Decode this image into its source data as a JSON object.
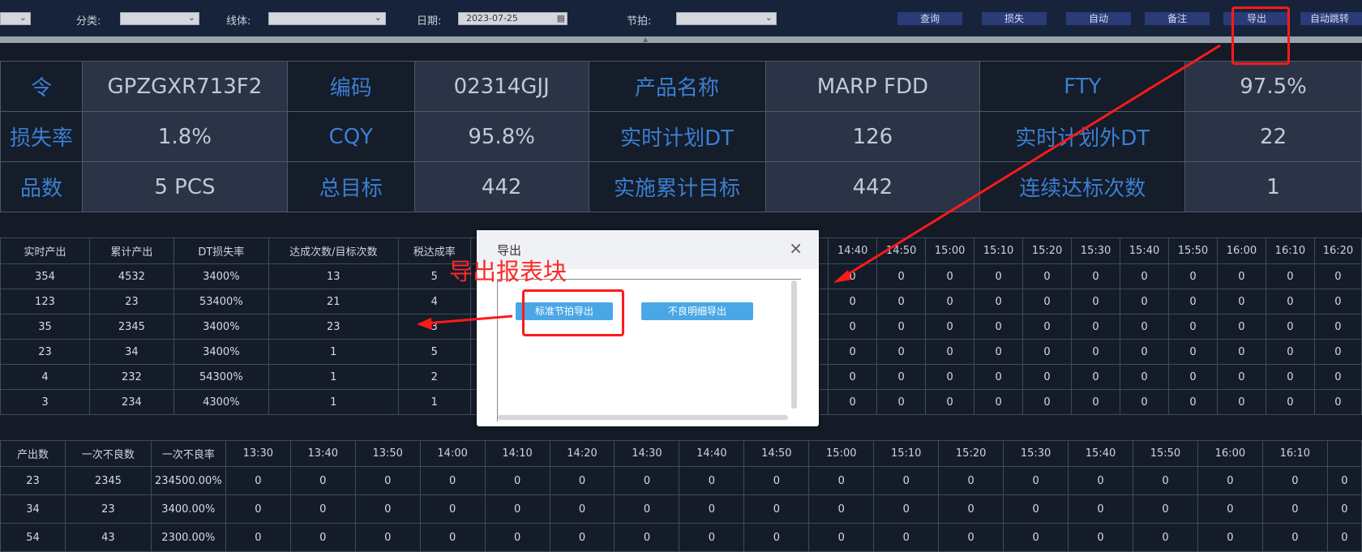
{
  "toolbar": {
    "category_label": "分类:",
    "line_label": "线体:",
    "date_label": "日期:",
    "date_value": "2023-07-25",
    "takt_label": "节拍:",
    "buttons": [
      "查询",
      "损失",
      "自动",
      "备注",
      "导出",
      "自动跳转"
    ]
  },
  "info_rows": [
    [
      "令",
      "GPZGXR713F2",
      "编码",
      "02314GJJ",
      "产品名称",
      "MARP FDD",
      "FTY",
      "97.5%"
    ],
    [
      "损失率",
      "1.8%",
      "CQY",
      "95.8%",
      "实时计划DT",
      "126",
      "实时计划外DT",
      "22"
    ],
    [
      "品数",
      "5 PCS",
      "总目标",
      "442",
      "实施累计目标",
      "442",
      "连续达标次数",
      "1"
    ]
  ],
  "table1": {
    "headers": [
      "实时产出",
      "累计产出",
      "DT损失率",
      "达成次数/目标次数",
      "税达成率",
      "",
      "14:40",
      "14:50",
      "15:00",
      "15:10",
      "15:20",
      "15:30",
      "15:40",
      "15:50",
      "16:00",
      "16:10",
      "16:20"
    ],
    "rows": [
      [
        "354",
        "4532",
        "3400%",
        "13",
        "5",
        "",
        "0",
        "0",
        "0",
        "0",
        "0",
        "0",
        "0",
        "0",
        "0",
        "0",
        "0"
      ],
      [
        "123",
        "23",
        "53400%",
        "21",
        "4",
        "",
        "0",
        "0",
        "0",
        "0",
        "0",
        "0",
        "0",
        "0",
        "0",
        "0",
        "0"
      ],
      [
        "35",
        "2345",
        "3400%",
        "23",
        "3",
        "",
        "0",
        "0",
        "0",
        "0",
        "0",
        "0",
        "0",
        "0",
        "0",
        "0",
        "0"
      ],
      [
        "23",
        "34",
        "3400%",
        "1",
        "5",
        "",
        "0",
        "0",
        "0",
        "0",
        "0",
        "0",
        "0",
        "0",
        "0",
        "0",
        "0"
      ],
      [
        "4",
        "232",
        "54300%",
        "1",
        "2",
        "",
        "0",
        "0",
        "0",
        "0",
        "0",
        "0",
        "0",
        "0",
        "0",
        "0",
        "0"
      ],
      [
        "3",
        "234",
        "4300%",
        "1",
        "1",
        "",
        "0",
        "0",
        "0",
        "0",
        "0",
        "0",
        "0",
        "0",
        "0",
        "0",
        "0"
      ]
    ]
  },
  "table2": {
    "headers": [
      "产出数",
      "一次不良数",
      "一次不良率",
      "13:30",
      "13:40",
      "13:50",
      "14:00",
      "14:10",
      "14:20",
      "14:30",
      "14:40",
      "14:50",
      "15:00",
      "15:10",
      "15:20",
      "15:30",
      "15:40",
      "15:50",
      "16:00",
      "16:10",
      ""
    ],
    "rows": [
      [
        "23",
        "2345",
        "234500.00%",
        "0",
        "0",
        "0",
        "0",
        "0",
        "0",
        "0",
        "0",
        "0",
        "0",
        "0",
        "0",
        "0",
        "0",
        "0",
        "0",
        "0",
        "0"
      ],
      [
        "34",
        "23",
        "3400.00%",
        "0",
        "0",
        "0",
        "0",
        "0",
        "0",
        "0",
        "0",
        "0",
        "0",
        "0",
        "0",
        "0",
        "0",
        "0",
        "0",
        "0",
        "0"
      ],
      [
        "54",
        "43",
        "2300.00%",
        "0",
        "0",
        "0",
        "0",
        "0",
        "0",
        "0",
        "0",
        "0",
        "0",
        "0",
        "0",
        "0",
        "0",
        "0",
        "0",
        "0",
        "0"
      ]
    ]
  },
  "modal": {
    "title": "导出",
    "close_icon": "close-icon",
    "buttons": [
      "标准节拍导出",
      "不良明细导出"
    ]
  },
  "annotation": {
    "text": "导出报表块",
    "color": "#ff1a1a"
  },
  "colors": {
    "topbar": "#16233a",
    "label_blue": "#3c7fd0",
    "button_blue": "#4aa7e6"
  }
}
